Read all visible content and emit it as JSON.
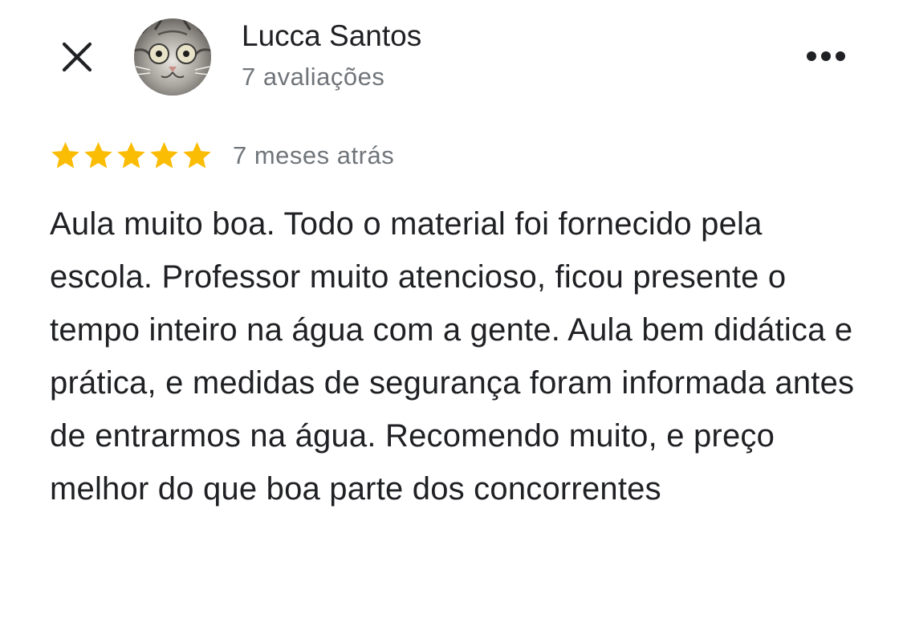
{
  "header": {
    "close_icon": "close-icon",
    "avatar_icon": "cat-avatar",
    "reviewer_name": "Lucca Santos",
    "review_count": "7 avaliações",
    "more_icon": "more-horizontal-icon"
  },
  "review": {
    "rating": 5,
    "rating_max": 5,
    "star_color": "#fbbc04",
    "date": "7 meses atrás",
    "text": "Aula muito boa. Todo o material foi fornecido pela escola. Professor muito atencioso, ficou presente o tempo inteiro na água com a gente. Aula bem didática e prática, e medidas de segurança foram informada antes de entrarmos na água. Recomendo muito, e preço melhor do que boa parte dos concorrentes"
  }
}
